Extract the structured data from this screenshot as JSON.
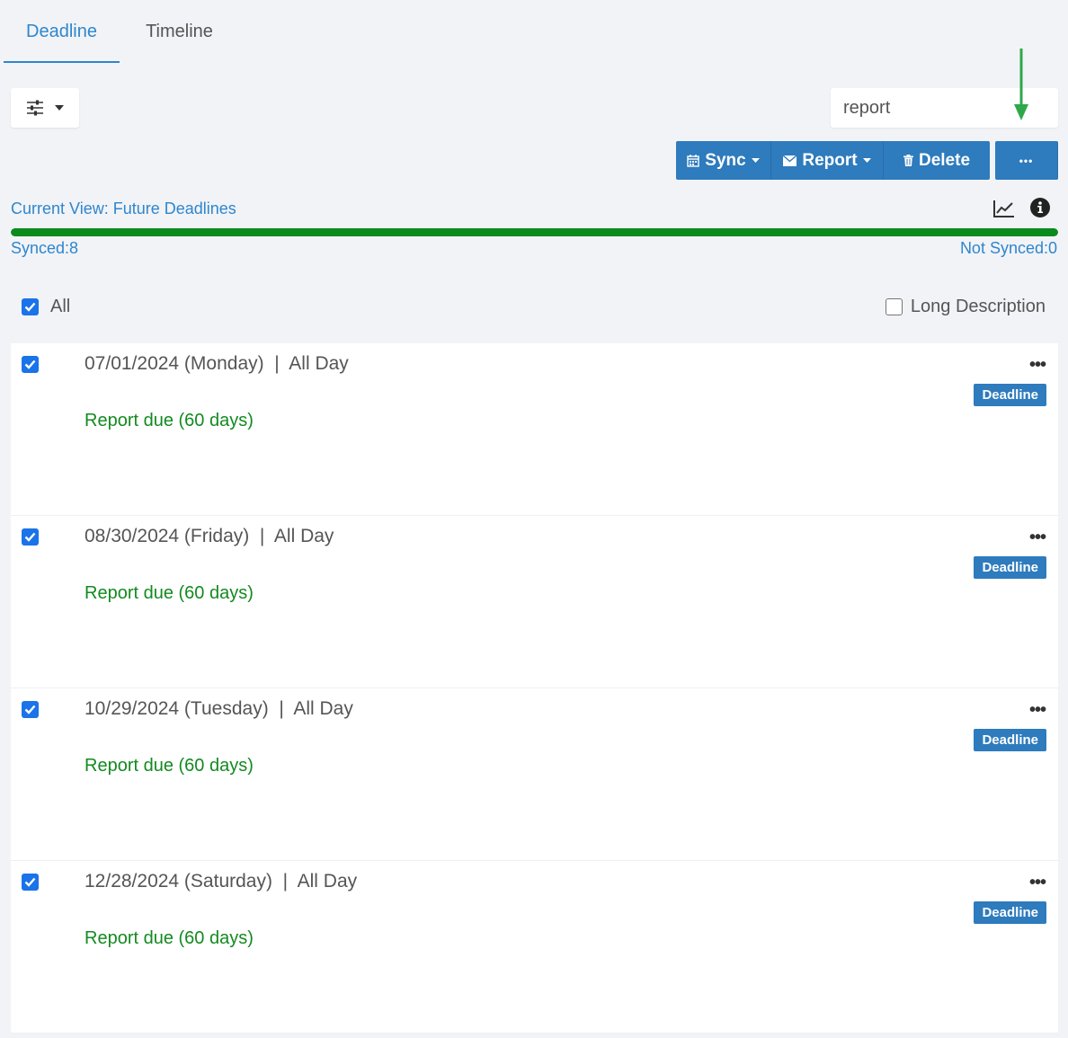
{
  "tabs": [
    {
      "label": "Deadline",
      "active": true
    },
    {
      "label": "Timeline",
      "active": false
    }
  ],
  "search": {
    "value": "report"
  },
  "toolbar": {
    "sync_label": "Sync",
    "report_label": "Report",
    "delete_label": "Delete",
    "more_label": "•••"
  },
  "view": {
    "current_view": "Current View: Future Deadlines",
    "synced": "Synced:8",
    "not_synced": "Not Synced:0",
    "sync_progress_percent": 100
  },
  "select_all": {
    "label": "All",
    "checked": true
  },
  "long_description": {
    "label": "Long Description",
    "checked": false
  },
  "items": [
    {
      "date": "07/01/2024 (Monday)  |  All Day",
      "description": "Report due (60 days)",
      "badge": "Deadline",
      "checked": true
    },
    {
      "date": "08/30/2024 (Friday)  |  All Day",
      "description": "Report due (60 days)",
      "badge": "Deadline",
      "checked": true
    },
    {
      "date": "10/29/2024 (Tuesday)  |  All Day",
      "description": "Report due (60 days)",
      "badge": "Deadline",
      "checked": true
    },
    {
      "date": "12/28/2024 (Saturday)  |  All Day",
      "description": "Report due (60 days)",
      "badge": "Deadline",
      "checked": true
    }
  ],
  "colors": {
    "accent": "#2f86cc",
    "button": "#2e7bbd",
    "progress": "#0b8a1d",
    "description": "#138a20",
    "annotation_arrow": "#2ea84a"
  },
  "icons": {
    "filter": "sliders-icon",
    "chart": "line-chart-icon",
    "info": "info-circle-icon",
    "calendar": "calendar-icon",
    "envelope": "envelope-icon",
    "trash": "trash-icon"
  }
}
